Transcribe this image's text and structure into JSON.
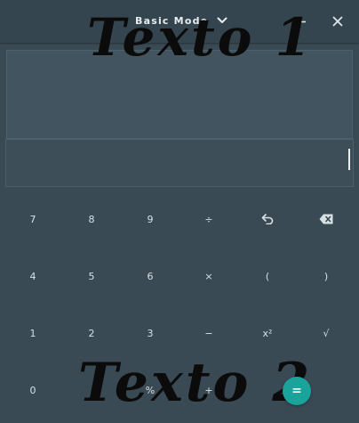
{
  "titlebar": {
    "mode_label": "Basic Mode",
    "mode_icon": "chevron-down-icon",
    "minimize_icon": "minimize-icon",
    "close_icon": "close-icon"
  },
  "display": {
    "history": "",
    "expression": ""
  },
  "keypad": {
    "rows": [
      [
        {
          "label": "7",
          "name": "key-7"
        },
        {
          "label": "8",
          "name": "key-8"
        },
        {
          "label": "9",
          "name": "key-9"
        },
        {
          "label": "÷",
          "name": "key-divide"
        },
        {
          "label": "",
          "name": "undo-button",
          "icon": "undo-icon"
        },
        {
          "label": "",
          "name": "backspace-button",
          "icon": "backspace-icon"
        }
      ],
      [
        {
          "label": "4",
          "name": "key-4"
        },
        {
          "label": "5",
          "name": "key-5"
        },
        {
          "label": "6",
          "name": "key-6"
        },
        {
          "label": "×",
          "name": "key-multiply"
        },
        {
          "label": "(",
          "name": "key-open-paren"
        },
        {
          "label": ")",
          "name": "key-close-paren"
        }
      ],
      [
        {
          "label": "1",
          "name": "key-1"
        },
        {
          "label": "2",
          "name": "key-2"
        },
        {
          "label": "3",
          "name": "key-3"
        },
        {
          "label": "−",
          "name": "key-subtract"
        },
        {
          "label": "x²",
          "name": "key-square"
        },
        {
          "label": "√",
          "name": "key-sqrt"
        }
      ],
      [
        {
          "label": "0",
          "name": "key-0"
        },
        {
          "label": ".",
          "name": "key-decimal"
        },
        {
          "label": "%",
          "name": "key-percent"
        },
        {
          "label": "+",
          "name": "key-add"
        }
      ]
    ],
    "equals_label": "="
  },
  "overlays": {
    "text_1": "Texto 1",
    "text_2": "Texto 2"
  },
  "colors": {
    "background": "#3a4a54",
    "titlebar": "#35454f",
    "accent": "#1aa39b",
    "key_text": "#d8e0e4"
  }
}
